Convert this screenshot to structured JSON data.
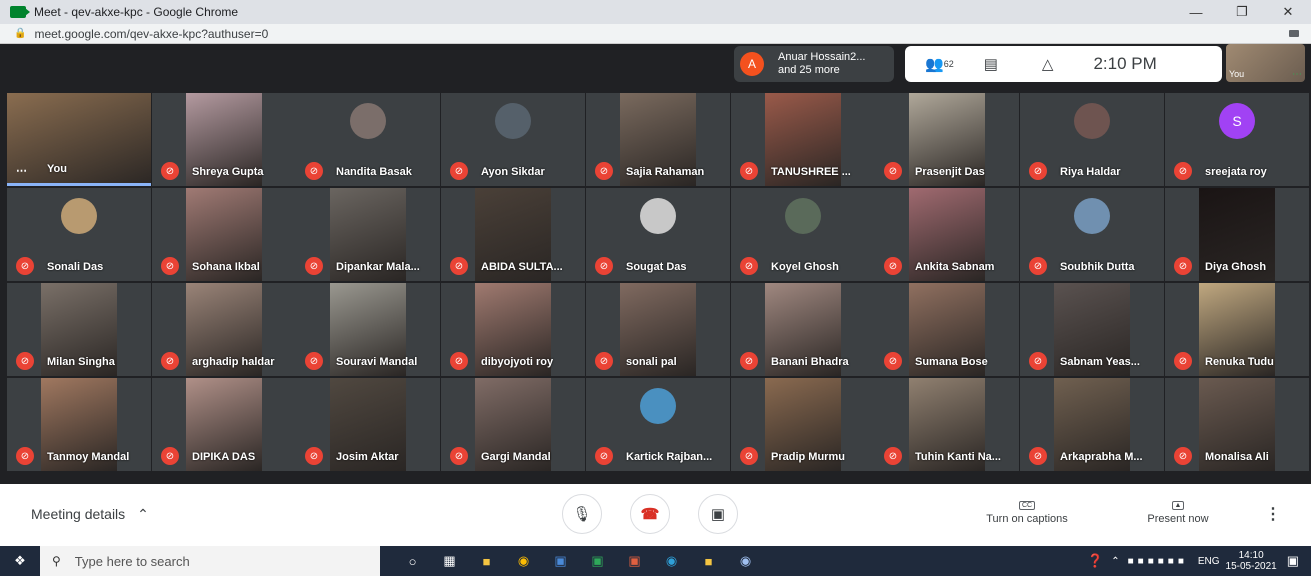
{
  "browser": {
    "window_title": "Meet - qev-akxe-kpc - Google Chrome",
    "url": "meet.google.com/qev-akxe-kpc?authuser=0"
  },
  "meet_header": {
    "speaker_initial": "A",
    "speaker_line1": "Anuar Hossain2...",
    "speaker_line2": "and 25 more",
    "participant_count": "62",
    "time": "2:10 PM",
    "self_label": "You"
  },
  "tiles": [
    {
      "name": "You",
      "kind": "video",
      "color": "#8a6d50"
    },
    {
      "name": "Shreya Gupta",
      "kind": "video",
      "color": "#b49aa0"
    },
    {
      "name": "Nandita Basak",
      "kind": "avatar",
      "color": "#7b6e6a"
    },
    {
      "name": "Ayon Sikdar",
      "kind": "avatar",
      "color": "#55606a"
    },
    {
      "name": "Sajia Rahaman",
      "kind": "video",
      "color": "#7a6a5e"
    },
    {
      "name": "TANUSHREE ...",
      "kind": "video",
      "color": "#9a5a4a"
    },
    {
      "name": "Prasenjit Das",
      "kind": "video",
      "color": "#b0a89a"
    },
    {
      "name": "Riya Haldar",
      "kind": "avatar",
      "color": "#6e5450"
    },
    {
      "name": "sreejata roy",
      "kind": "letter",
      "letter": "S",
      "color": "#a142f4"
    },
    {
      "name": "Sonali Das",
      "kind": "avatar",
      "color": "#b89a70"
    },
    {
      "name": "Sohana Ikbal",
      "kind": "video",
      "color": "#a07a74"
    },
    {
      "name": "Dipankar Mala...",
      "kind": "video",
      "color": "#6a6560"
    },
    {
      "name": "ABIDA SULTA...",
      "kind": "video",
      "color": "#4a4038"
    },
    {
      "name": "Sougat Das",
      "kind": "avatar",
      "color": "#c8c8c8"
    },
    {
      "name": "Koyel Ghosh",
      "kind": "avatar",
      "color": "#5a6a5a"
    },
    {
      "name": "Ankita Sabnam",
      "kind": "video",
      "color": "#a06a70"
    },
    {
      "name": "Soubhik Dutta",
      "kind": "avatar",
      "color": "#7090b0"
    },
    {
      "name": "Diya Ghosh",
      "kind": "video",
      "color": "#1a1414"
    },
    {
      "name": "Milan Singha",
      "kind": "video",
      "color": "#7a7068"
    },
    {
      "name": "arghadip haldar",
      "kind": "video",
      "color": "#9a8478"
    },
    {
      "name": "Souravi Mandal",
      "kind": "video",
      "color": "#9a9890"
    },
    {
      "name": "dibyojyoti roy",
      "kind": "video",
      "color": "#a07a70"
    },
    {
      "name": "sonali pal",
      "kind": "video",
      "color": "#806a60"
    },
    {
      "name": "Banani Bhadra",
      "kind": "video",
      "color": "#a08880"
    },
    {
      "name": "Sumana Bose",
      "kind": "video",
      "color": "#907060"
    },
    {
      "name": "Sabnam Yeas...",
      "kind": "video",
      "color": "#5a5250"
    },
    {
      "name": "Renuka Tudu",
      "kind": "video",
      "color": "#c0a880"
    },
    {
      "name": "Tanmoy Mandal",
      "kind": "video",
      "color": "#a07860"
    },
    {
      "name": "DIPIKA DAS",
      "kind": "video",
      "color": "#b09088"
    },
    {
      "name": "Josim Aktar",
      "kind": "video",
      "color": "#504840"
    },
    {
      "name": "Gargi Mandal",
      "kind": "video",
      "color": "#806c66"
    },
    {
      "name": "Kartick Rajban...",
      "kind": "avatar",
      "color": "#4a90c0"
    },
    {
      "name": "Pradip Murmu",
      "kind": "video",
      "color": "#8a6a50"
    },
    {
      "name": "Tuhin Kanti Na...",
      "kind": "video",
      "color": "#908070"
    },
    {
      "name": "Arkaprabha M...",
      "kind": "video",
      "color": "#706050"
    },
    {
      "name": "Monalisa Ali",
      "kind": "video",
      "color": "#6a5a50"
    }
  ],
  "bottom": {
    "meeting_details": "Meeting details",
    "captions_label": "Turn on captions",
    "captions_icon": "CC",
    "present_label": "Present now"
  },
  "taskbar": {
    "search_placeholder": "Type here to search",
    "lang": "ENG",
    "time": "14:10",
    "date": "15-05-2021"
  }
}
